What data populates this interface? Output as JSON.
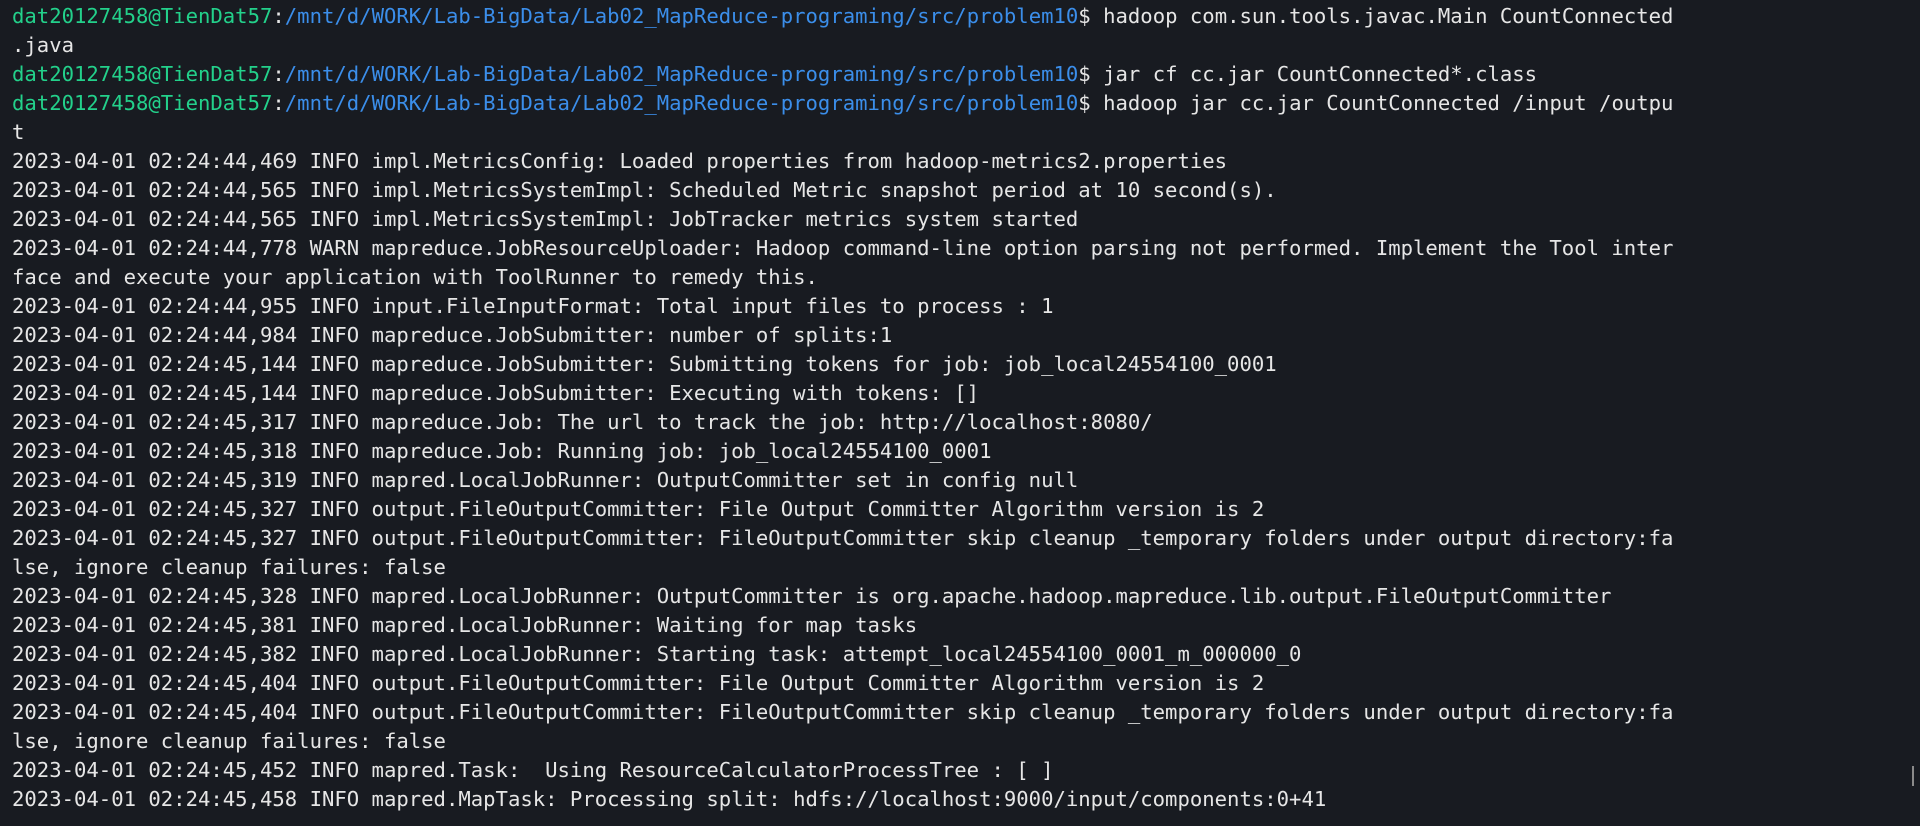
{
  "terminal": {
    "colors": {
      "background": "#181b21",
      "foreground": "#e6e6e6",
      "prompt_user": "#23d18b",
      "prompt_path": "#3b8eea"
    },
    "prompt": {
      "user_host": "dat20127458@TienDat57",
      "sep": ":",
      "path": "/mnt/d/WORK/Lab-BigData/Lab02_MapReduce-programing/src/problem10",
      "symbol": "$ "
    },
    "commands": [
      "hadoop com.sun.tools.javac.Main CountConnected",
      "jar cf cc.jar CountConnected*.class",
      "hadoop jar cc.jar CountConnected /input /outpu"
    ],
    "wraps": [
      ".java",
      "t"
    ],
    "log_lines": [
      "2023-04-01 02:24:44,469 INFO impl.MetricsConfig: Loaded properties from hadoop-metrics2.properties",
      "2023-04-01 02:24:44,565 INFO impl.MetricsSystemImpl: Scheduled Metric snapshot period at 10 second(s).",
      "2023-04-01 02:24:44,565 INFO impl.MetricsSystemImpl: JobTracker metrics system started",
      "2023-04-01 02:24:44,778 WARN mapreduce.JobResourceUploader: Hadoop command-line option parsing not performed. Implement the Tool inter",
      "face and execute your application with ToolRunner to remedy this.",
      "2023-04-01 02:24:44,955 INFO input.FileInputFormat: Total input files to process : 1",
      "2023-04-01 02:24:44,984 INFO mapreduce.JobSubmitter: number of splits:1",
      "2023-04-01 02:24:45,144 INFO mapreduce.JobSubmitter: Submitting tokens for job: job_local24554100_0001",
      "2023-04-01 02:24:45,144 INFO mapreduce.JobSubmitter: Executing with tokens: []",
      "2023-04-01 02:24:45,317 INFO mapreduce.Job: The url to track the job: http://localhost:8080/",
      "2023-04-01 02:24:45,318 INFO mapreduce.Job: Running job: job_local24554100_0001",
      "2023-04-01 02:24:45,319 INFO mapred.LocalJobRunner: OutputCommitter set in config null",
      "2023-04-01 02:24:45,327 INFO output.FileOutputCommitter: File Output Committer Algorithm version is 2",
      "2023-04-01 02:24:45,327 INFO output.FileOutputCommitter: FileOutputCommitter skip cleanup _temporary folders under output directory:fa",
      "lse, ignore cleanup failures: false",
      "2023-04-01 02:24:45,328 INFO mapred.LocalJobRunner: OutputCommitter is org.apache.hadoop.mapreduce.lib.output.FileOutputCommitter",
      "2023-04-01 02:24:45,381 INFO mapred.LocalJobRunner: Waiting for map tasks",
      "2023-04-01 02:24:45,382 INFO mapred.LocalJobRunner: Starting task: attempt_local24554100_0001_m_000000_0",
      "2023-04-01 02:24:45,404 INFO output.FileOutputCommitter: File Output Committer Algorithm version is 2",
      "2023-04-01 02:24:45,404 INFO output.FileOutputCommitter: FileOutputCommitter skip cleanup _temporary folders under output directory:fa",
      "lse, ignore cleanup failures: false",
      "2023-04-01 02:24:45,452 INFO mapred.Task:  Using ResourceCalculatorProcessTree : [ ]",
      "2023-04-01 02:24:45,458 INFO mapred.MapTask: Processing split: hdfs://localhost:9000/input/components:0+41"
    ]
  }
}
